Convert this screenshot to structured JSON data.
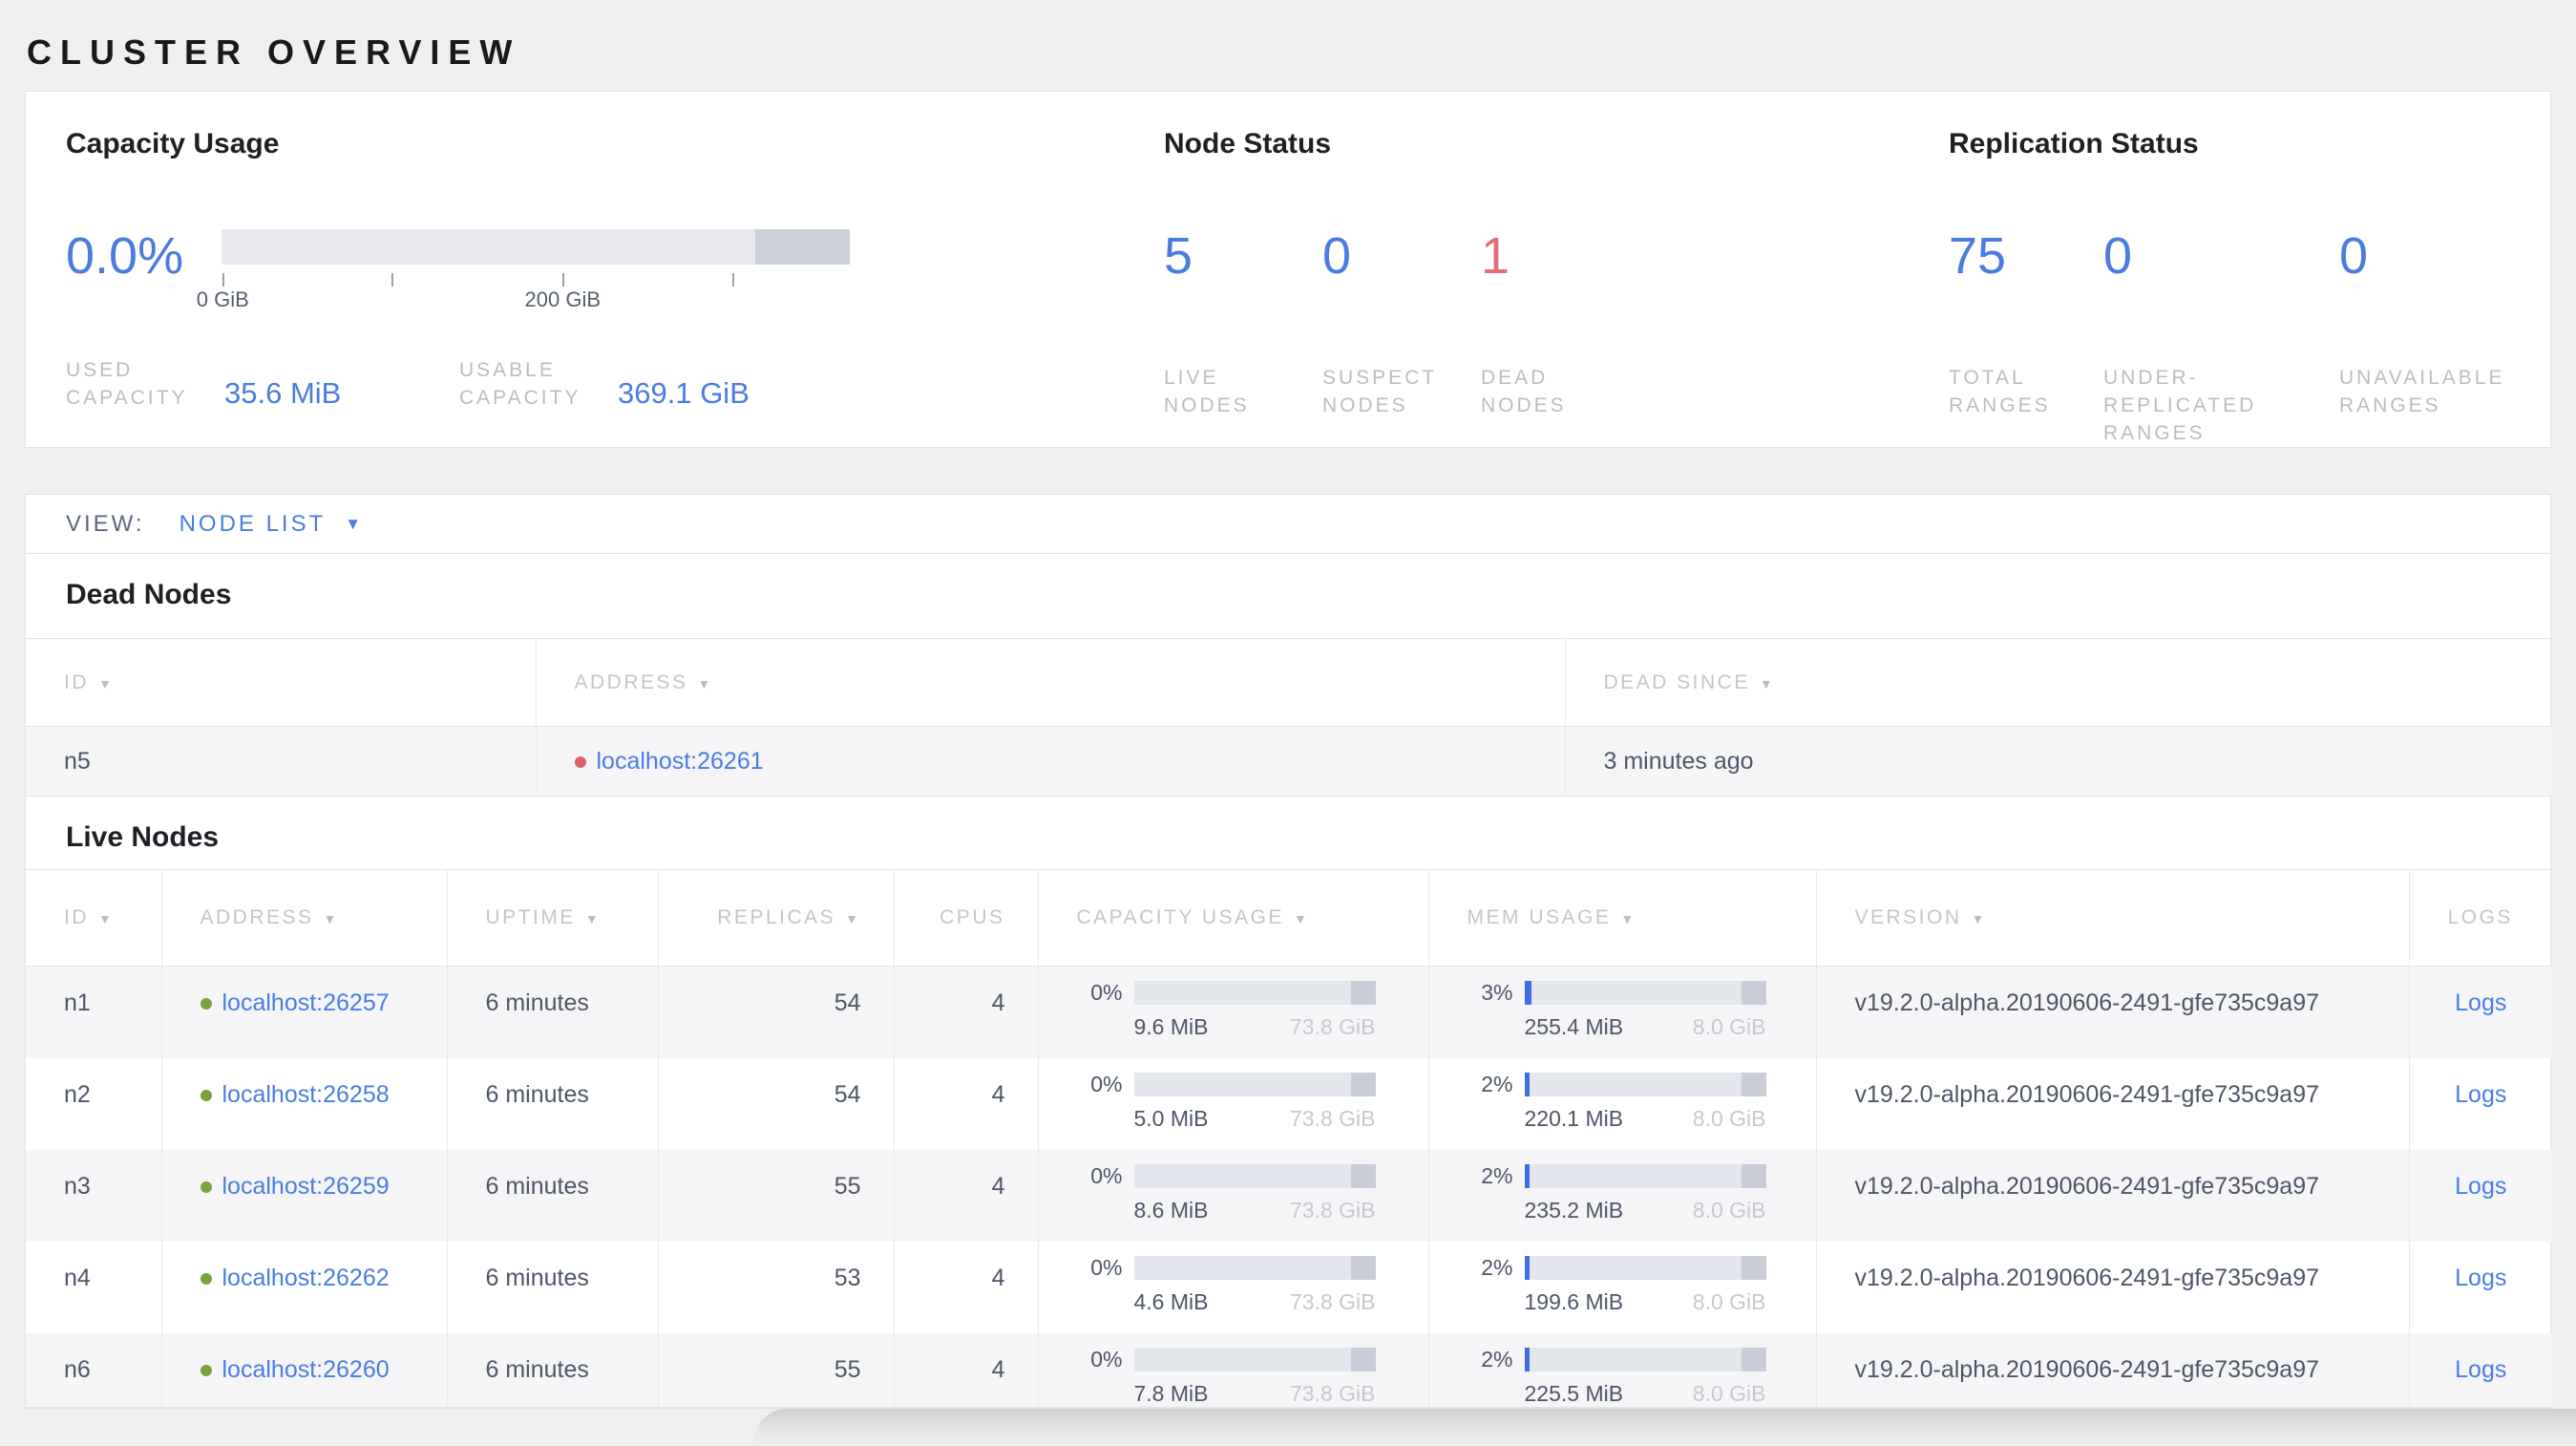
{
  "page_title": "CLUSTER OVERVIEW",
  "colors": {
    "accent_blue": "#4a7ce0",
    "dead_red": "#e26e78",
    "live_dot_green": "#7ba33c",
    "dead_dot_red": "#d9626c"
  },
  "summary_cards": {
    "capacity": {
      "title": "Capacity Usage",
      "percent_label": "0.0%",
      "bar": {
        "dark_segment_start_pct": 85,
        "tick_positions_pct": [
          0.2,
          27,
          54.3,
          81.3
        ]
      },
      "axis_tick_labels": [
        {
          "text": "0 GiB",
          "pos_pct": 0.2
        },
        {
          "text": "200 GiB",
          "pos_pct": 54.3
        }
      ],
      "stats": [
        {
          "label_lines": [
            "USED",
            "CAPACITY"
          ],
          "value": "35.6 MiB"
        },
        {
          "label_lines": [
            "USABLE",
            "CAPACITY"
          ],
          "value": "369.1 GiB"
        }
      ]
    },
    "node_status": {
      "title": "Node Status",
      "stats": [
        {
          "value": "5",
          "label_lines": [
            "LIVE",
            "NODES"
          ],
          "color": "#4a7ce0"
        },
        {
          "value": "0",
          "label_lines": [
            "SUSPECT",
            "NODES"
          ],
          "color": "#4a7ce0"
        },
        {
          "value": "1",
          "label_lines": [
            "DEAD",
            "NODES"
          ],
          "color": "#e26e78"
        }
      ]
    },
    "replication_status": {
      "title": "Replication Status",
      "stats": [
        {
          "value": "75",
          "label_lines": [
            "TOTAL",
            "RANGES"
          ],
          "color": "#4a7ce0"
        },
        {
          "value": "0",
          "label_lines": [
            "UNDER-",
            "REPLICATED",
            "RANGES"
          ],
          "color": "#4a7ce0"
        },
        {
          "value": "0",
          "label_lines": [
            "UNAVAILABLE",
            "RANGES"
          ],
          "color": "#4a7ce0"
        }
      ]
    }
  },
  "view_bar": {
    "label": "VIEW:",
    "selected": "NODE LIST"
  },
  "dead_nodes": {
    "section_title": "Dead Nodes",
    "columns": [
      {
        "label": "ID",
        "sortable": true
      },
      {
        "label": "ADDRESS",
        "sortable": true
      },
      {
        "label": "DEAD SINCE",
        "sortable": true
      }
    ],
    "rows": [
      {
        "id": "n5",
        "address": "localhost:26261",
        "dead_since": "3 minutes ago"
      }
    ]
  },
  "live_nodes": {
    "section_title": "Live Nodes",
    "logs_label": "Logs",
    "columns": [
      {
        "label": "ID",
        "sortable": true
      },
      {
        "label": "ADDRESS",
        "sortable": true
      },
      {
        "label": "UPTIME",
        "sortable": true
      },
      {
        "label": "REPLICAS",
        "sortable": true
      },
      {
        "label": "CPUS",
        "sortable": false
      },
      {
        "label": "CAPACITY USAGE",
        "sortable": true
      },
      {
        "label": "MEM USAGE",
        "sortable": true
      },
      {
        "label": "VERSION",
        "sortable": true
      },
      {
        "label": "LOGS",
        "sortable": false
      }
    ],
    "rows": [
      {
        "id": "n1",
        "address": "localhost:26257",
        "uptime": "6 minutes",
        "replicas": "54",
        "cpus": "4",
        "capacity": {
          "percent": "0%",
          "fill_pct": 0,
          "used": "9.6 MiB",
          "total": "73.8 GiB"
        },
        "mem": {
          "percent": "3%",
          "fill_pct": 3,
          "used": "255.4 MiB",
          "total": "8.0 GiB"
        },
        "version": "v19.2.0-alpha.20190606-2491-gfe735c9a97"
      },
      {
        "id": "n2",
        "address": "localhost:26258",
        "uptime": "6 minutes",
        "replicas": "54",
        "cpus": "4",
        "capacity": {
          "percent": "0%",
          "fill_pct": 0,
          "used": "5.0 MiB",
          "total": "73.8 GiB"
        },
        "mem": {
          "percent": "2%",
          "fill_pct": 2,
          "used": "220.1 MiB",
          "total": "8.0 GiB"
        },
        "version": "v19.2.0-alpha.20190606-2491-gfe735c9a97"
      },
      {
        "id": "n3",
        "address": "localhost:26259",
        "uptime": "6 minutes",
        "replicas": "55",
        "cpus": "4",
        "capacity": {
          "percent": "0%",
          "fill_pct": 0,
          "used": "8.6 MiB",
          "total": "73.8 GiB"
        },
        "mem": {
          "percent": "2%",
          "fill_pct": 2,
          "used": "235.2 MiB",
          "total": "8.0 GiB"
        },
        "version": "v19.2.0-alpha.20190606-2491-gfe735c9a97"
      },
      {
        "id": "n4",
        "address": "localhost:26262",
        "uptime": "6 minutes",
        "replicas": "53",
        "cpus": "4",
        "capacity": {
          "percent": "0%",
          "fill_pct": 0,
          "used": "4.6 MiB",
          "total": "73.8 GiB"
        },
        "mem": {
          "percent": "2%",
          "fill_pct": 2,
          "used": "199.6 MiB",
          "total": "8.0 GiB"
        },
        "version": "v19.2.0-alpha.20190606-2491-gfe735c9a97"
      },
      {
        "id": "n6",
        "address": "localhost:26260",
        "uptime": "6 minutes",
        "replicas": "55",
        "cpus": "4",
        "capacity": {
          "percent": "0%",
          "fill_pct": 0,
          "used": "7.8 MiB",
          "total": "73.8 GiB"
        },
        "mem": {
          "percent": "2%",
          "fill_pct": 2,
          "used": "225.5 MiB",
          "total": "8.0 GiB"
        },
        "version": "v19.2.0-alpha.20190606-2491-gfe735c9a97"
      }
    ]
  }
}
